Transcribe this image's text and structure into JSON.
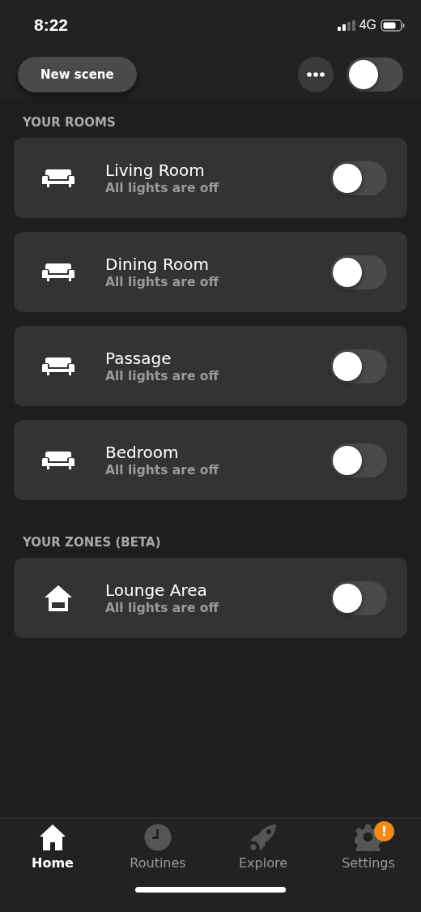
{
  "status_bar": {
    "time": "8:22",
    "network": "4G"
  },
  "header": {
    "new_scene_button": "New scene",
    "all_lights_on": false
  },
  "sections": [
    {
      "title": "YOUR ROOMS",
      "items": [
        {
          "kind": "sofa",
          "name": "Living Room",
          "status": "All lights are off",
          "on": false
        },
        {
          "kind": "sofa",
          "name": "Dining Room",
          "status": "All lights are off",
          "on": false
        },
        {
          "kind": "sofa",
          "name": "Passage",
          "status": "All lights are off",
          "on": false
        },
        {
          "kind": "sofa",
          "name": "Bedroom",
          "status": "All lights are off",
          "on": false
        }
      ]
    },
    {
      "title": "YOUR ZONES (BETA)",
      "items": [
        {
          "kind": "house",
          "name": "Lounge Area",
          "status": "All lights are off",
          "on": false
        }
      ]
    }
  ],
  "tab_bar": [
    {
      "kind": "home",
      "label": "Home",
      "selected": true
    },
    {
      "kind": "clock",
      "label": "Routines",
      "selected": false
    },
    {
      "kind": "rocket",
      "label": "Explore",
      "selected": false
    },
    {
      "kind": "gear",
      "label": "Settings",
      "selected": false,
      "badge": "!"
    }
  ]
}
